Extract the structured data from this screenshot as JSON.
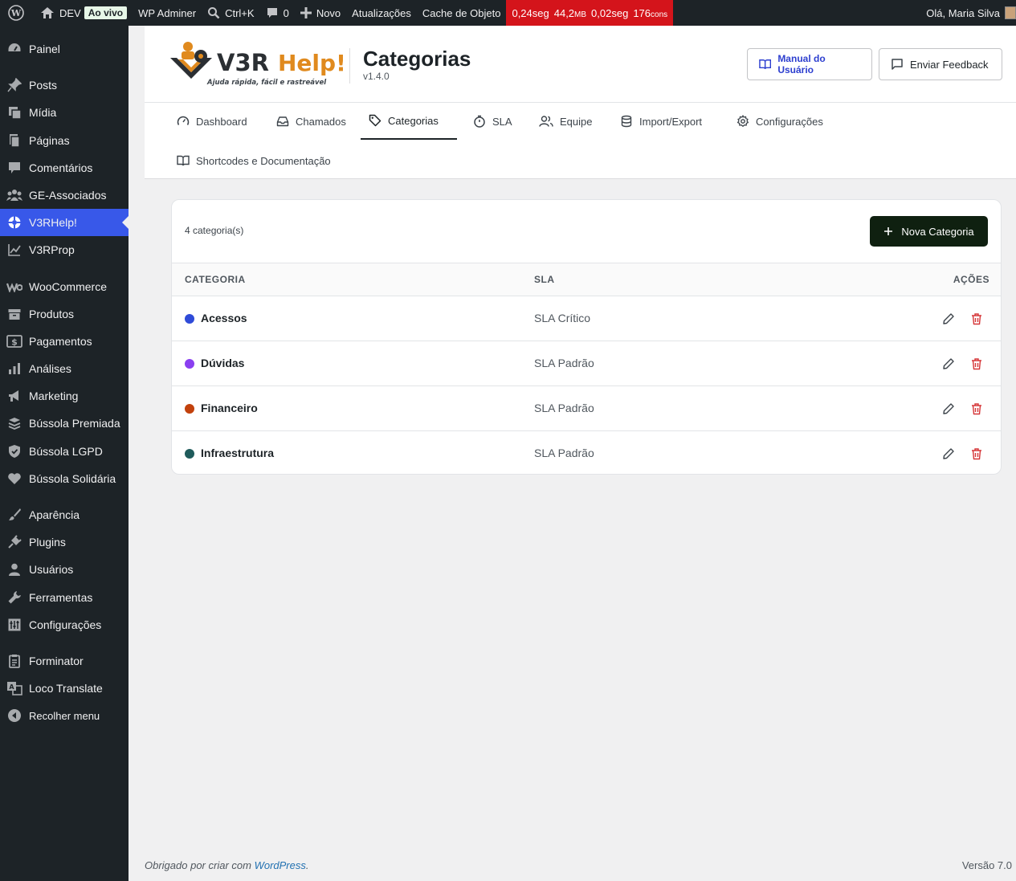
{
  "adminbar": {
    "site_name": "DEV",
    "live_badge": "Ao vivo",
    "wp_adminer": "WP Adminer",
    "search_shortcut": "Ctrl+K",
    "comments_count": "0",
    "new_label": "Novo",
    "updates_label": "Atualizações",
    "cache_label": "Cache de Objeto",
    "perf": {
      "time1": "0,24seg",
      "memory": "44,2",
      "memory_unit": "MB",
      "time2": "0,02seg",
      "queries": "176",
      "queries_unit": "cons"
    },
    "greeting": "Olá, Maria Silva"
  },
  "sidebar": {
    "items": [
      {
        "label": "Painel",
        "icon": "dashboard-icon"
      },
      {
        "label": "Posts",
        "icon": "pin-icon"
      },
      {
        "label": "Mídia",
        "icon": "media-icon"
      },
      {
        "label": "Páginas",
        "icon": "pages-icon"
      },
      {
        "label": "Comentários",
        "icon": "comment-icon"
      },
      {
        "label": "GE-Associados",
        "icon": "groups-icon"
      },
      {
        "label": "V3RHelp!",
        "icon": "lifebuoy-icon"
      },
      {
        "label": "V3RProp",
        "icon": "chart-line-icon"
      },
      {
        "label": "WooCommerce",
        "icon": "woo-icon"
      },
      {
        "label": "Produtos",
        "icon": "archive-icon"
      },
      {
        "label": "Pagamentos",
        "icon": "dollar-icon"
      },
      {
        "label": "Análises",
        "icon": "bar-chart-icon"
      },
      {
        "label": "Marketing",
        "icon": "megaphone-icon"
      },
      {
        "label": "Bússola Premiada",
        "icon": "stack-icon"
      },
      {
        "label": "Bússola LGPD",
        "icon": "shield-icon"
      },
      {
        "label": "Bússola Solidária",
        "icon": "heart-icon"
      },
      {
        "label": "Aparência",
        "icon": "brush-icon"
      },
      {
        "label": "Plugins",
        "icon": "plugin-icon"
      },
      {
        "label": "Usuários",
        "icon": "user-icon"
      },
      {
        "label": "Ferramentas",
        "icon": "wrench-icon"
      },
      {
        "label": "Configurações",
        "icon": "settings-icon"
      },
      {
        "label": "Forminator",
        "icon": "clipboard-icon"
      },
      {
        "label": "Loco Translate",
        "icon": "translate-icon"
      },
      {
        "label": "Recolher menu",
        "icon": "collapse-icon"
      }
    ]
  },
  "header": {
    "logo_text_v3r": "V3R",
    "logo_text_help": "Help!",
    "logo_tagline": "Ajuda rápida, fácil e rastreável",
    "title": "Categorias",
    "version": "v1.4.0",
    "manual_button": "Manual do Usuário",
    "feedback_button": "Enviar Feedback"
  },
  "tabs": [
    {
      "label": "Dashboard",
      "icon": "gauge-icon"
    },
    {
      "label": "Chamados",
      "icon": "inbox-icon"
    },
    {
      "label": "Categorias",
      "icon": "tag-icon"
    },
    {
      "label": "SLA",
      "icon": "timer-icon"
    },
    {
      "label": "Equipe",
      "icon": "users-icon"
    },
    {
      "label": "Import/Export",
      "icon": "database-icon"
    },
    {
      "label": "Configurações",
      "icon": "gear-icon"
    },
    {
      "label": "Shortcodes e Documentação",
      "icon": "book-icon"
    }
  ],
  "categories_card": {
    "count_label": "4 categoria(s)",
    "new_button": "Nova Categoria",
    "columns": {
      "category": "CATEGORIA",
      "sla": "SLA",
      "actions": "AÇÕES"
    },
    "rows": [
      {
        "name": "Acessos",
        "sla": "SLA Crítico",
        "color": "#2f4bd8"
      },
      {
        "name": "Dúvidas",
        "sla": "SLA Padrão",
        "color": "#8a3ff0"
      },
      {
        "name": "Financeiro",
        "sla": "SLA Padrão",
        "color": "#c2410c"
      },
      {
        "name": "Infraestrutura",
        "sla": "SLA Padrão",
        "color": "#1f5b5b"
      }
    ]
  },
  "footer": {
    "thanks_prefix": "Obrigado por criar com ",
    "thanks_link": "WordPress",
    "thanks_suffix": ".",
    "version": "Versão 7.0"
  },
  "colors": {
    "admin_bg": "#1d2327",
    "active_menu": "#3858e9",
    "perf_bar": "#d4141b",
    "primary_button": "#0f2010",
    "danger": "#d63638",
    "logo_orange": "#e08a1e"
  }
}
